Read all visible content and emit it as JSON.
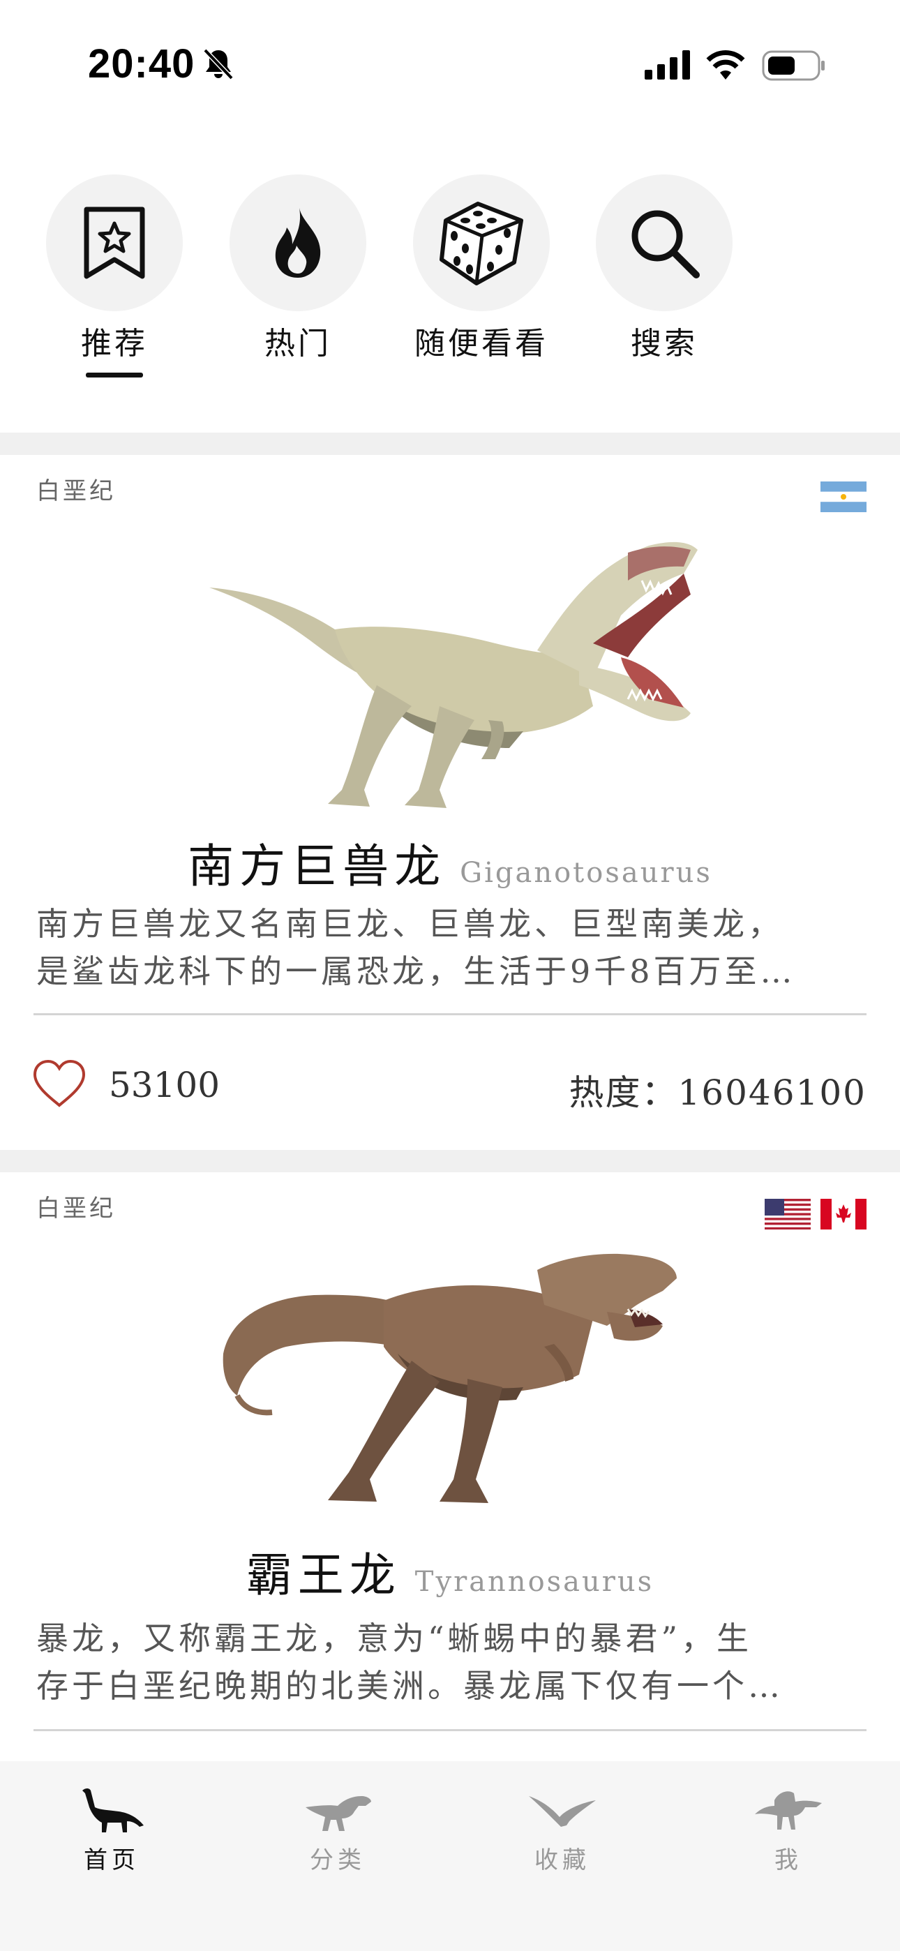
{
  "status": {
    "time": "20:40"
  },
  "topnav": {
    "items": [
      {
        "label": "推荐",
        "icon": "bookmark-star-icon",
        "active": true
      },
      {
        "label": "热门",
        "icon": "flame-icon",
        "active": false
      },
      {
        "label": "随便看看",
        "icon": "dice-icon",
        "active": false
      },
      {
        "label": "搜索",
        "icon": "search-icon",
        "active": false
      }
    ]
  },
  "cards": [
    {
      "period": "白垩纪",
      "flags": [
        "argentina-flag-icon"
      ],
      "cn_name": "南方巨兽龙",
      "latin_name": "Giganotosaurus",
      "desc_line1": "南方巨兽龙又名南巨龙、巨兽龙、巨型南美龙，",
      "desc_line2": "是鲨齿龙科下的一属恐龙，生活于9千8百万至…",
      "likes": "53100",
      "heat": "热度：16046100"
    },
    {
      "period": "白垩纪",
      "flags": [
        "usa-flag-icon",
        "canada-flag-icon"
      ],
      "cn_name": "霸王龙",
      "latin_name": "Tyrannosaurus",
      "desc_line1": "暴龙，又称霸王龙，意为“蜥蜴中的暴君”，生",
      "desc_line2": "存于白垩纪晚期的北美洲。暴龙属下仅有一个…"
    }
  ],
  "tabbar": {
    "items": [
      {
        "label": "首页",
        "icon": "brachiosaurus-icon",
        "active": true
      },
      {
        "label": "分类",
        "icon": "trex-icon",
        "active": false
      },
      {
        "label": "收藏",
        "icon": "pterosaur-icon",
        "active": false
      },
      {
        "label": "我",
        "icon": "spinosaurus-icon",
        "active": false
      }
    ]
  },
  "colors": {
    "heart": "#b03a2e",
    "active": "#111111",
    "inactive": "#999999",
    "gap": "#f0f0f0"
  }
}
